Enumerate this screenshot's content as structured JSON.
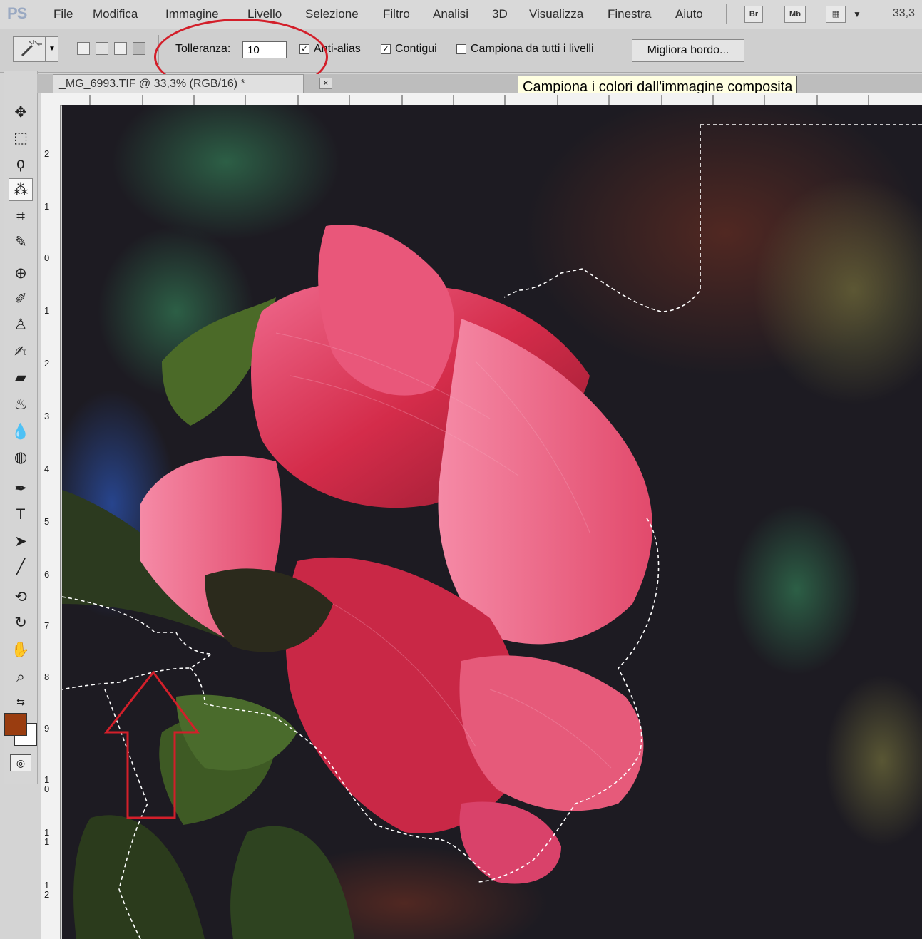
{
  "menubar": {
    "logo": "PS",
    "items": [
      "File",
      "Modifica",
      "Immagine",
      "Livello",
      "Selezione",
      "Filtro",
      "Analisi",
      "3D",
      "Visualizza",
      "Finestra",
      "Aiuto"
    ],
    "bridge_label": "Br",
    "minibridge_label": "Mb",
    "zoom": "33,3"
  },
  "options": {
    "tolerance_label": "Tolleranza:",
    "tolerance_value": "10",
    "antialias_label": "Anti-alias",
    "antialias_checked": true,
    "contiguous_label": "Contigui",
    "contiguous_checked": true,
    "sample_all_label": "Campiona da tutti i livelli",
    "sample_all_checked": false,
    "refine_edge_label": "Migliora bordo..."
  },
  "document": {
    "tab_title": "_MG_6993.TIF @ 33,3% (RGB/16) *",
    "tab_close": "×"
  },
  "tooltip": "Campiona i colori dall'immagine composita",
  "rulers": {
    "vertical_labels": [
      "2",
      "1",
      "0",
      "1",
      "2",
      "3",
      "4",
      "5",
      "6",
      "7",
      "8",
      "9",
      "10",
      "11",
      "12"
    ]
  },
  "colors": {
    "foreground": "#9a3d10",
    "background": "#ffffff",
    "annotation": "#d31f2a"
  }
}
